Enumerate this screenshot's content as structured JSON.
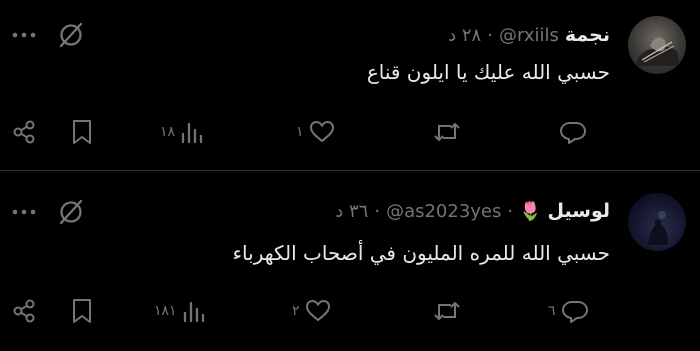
{
  "tweets": [
    {
      "name": "نجمة",
      "handle": "@rxiils",
      "time": "٢٨ د",
      "text": "حسبي الله عليك يا ايلون قناع",
      "views": "١٨",
      "likes": "١",
      "retweets": "",
      "replies": ""
    },
    {
      "name": "لوسيل",
      "flower": "🌷",
      "handle": "@as2023yes",
      "time": "٣٦ د",
      "text": "حسبي الله للمره المليون في أصحاب الكهرباء",
      "views": "١٨١",
      "likes": "٢",
      "retweets": "",
      "replies": "٦"
    }
  ],
  "separator": "·",
  "more_label": "···",
  "icons": {
    "share": "share-icon",
    "bookmark": "bookmark-icon",
    "views": "bar-chart-icon",
    "like": "heart-icon",
    "retweet": "retweet-icon",
    "reply": "reply-bubble-icon",
    "grok": "grok-icon",
    "more": "more-dots-icon"
  },
  "colors": {
    "background": "#000000",
    "text": "#e7e9ea",
    "muted": "#71767b",
    "divider": "#2f3336"
  }
}
